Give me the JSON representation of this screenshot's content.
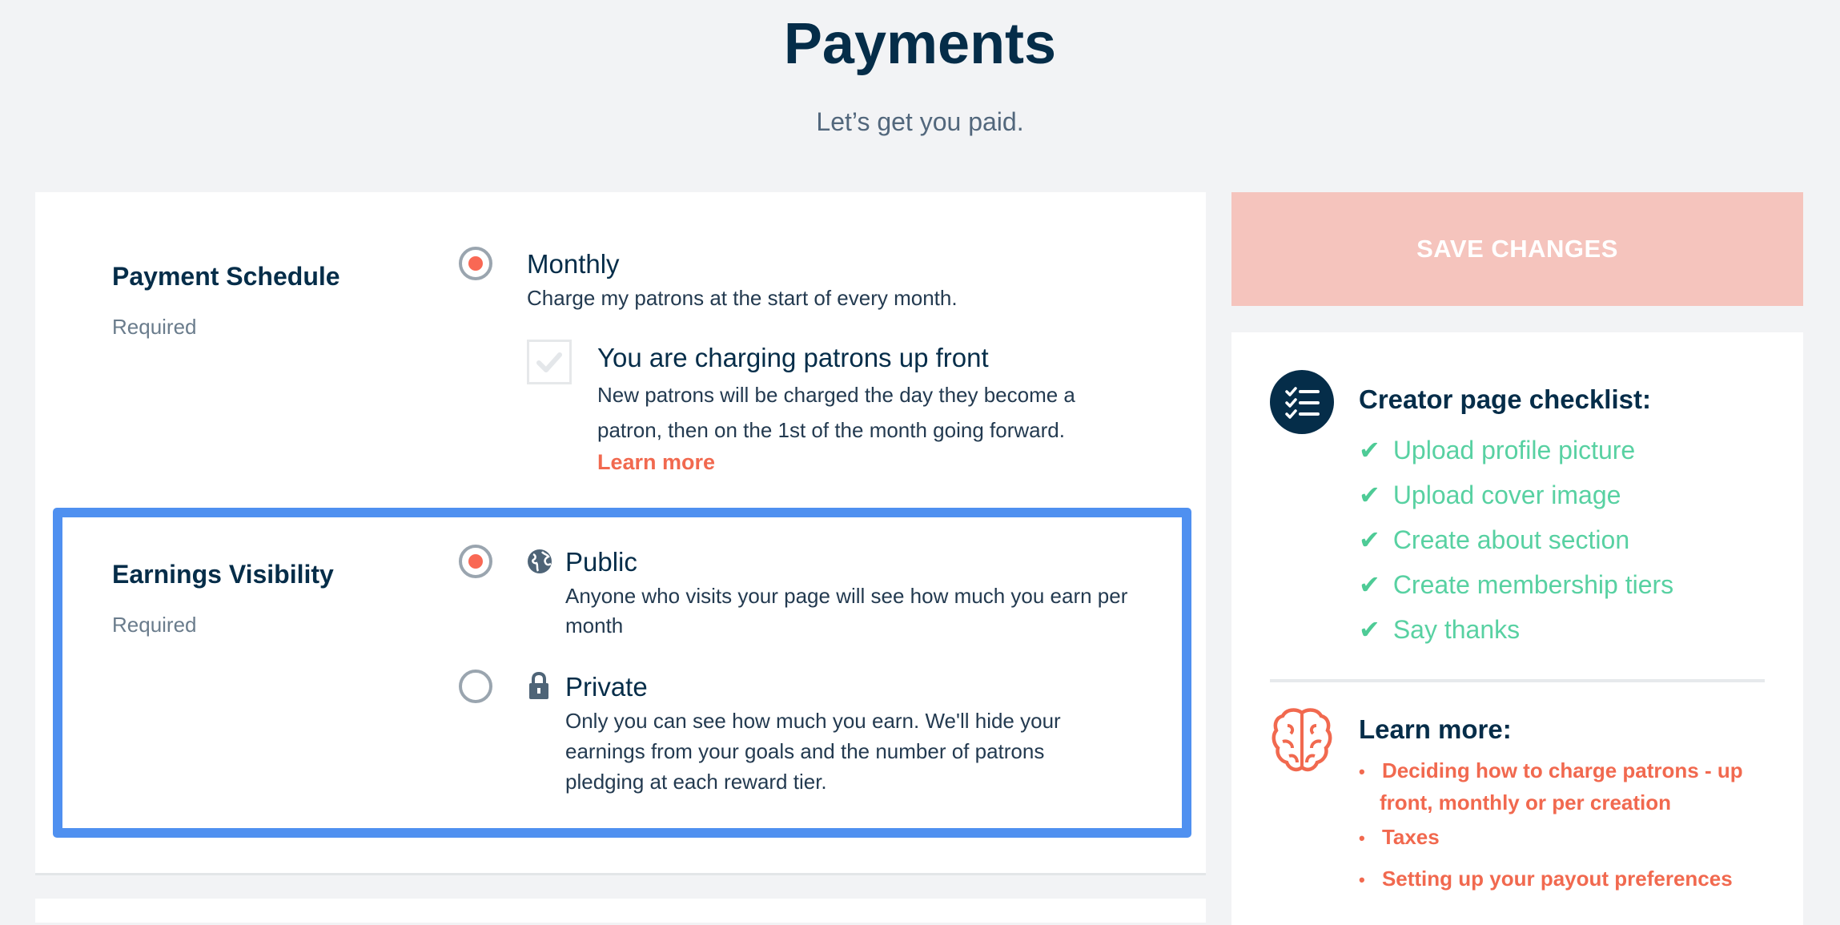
{
  "header": {
    "title": "Payments",
    "subtitle": "Let’s get you paid."
  },
  "payment_schedule": {
    "title": "Payment Schedule",
    "required": "Required",
    "option": {
      "label": "Monthly",
      "description": "Charge my patrons at the start of every month.",
      "selected": true
    },
    "upfront": {
      "label": "You are charging patrons up front",
      "description_line1": "New patrons will be charged the day they become a",
      "description_line2": "patron, then on the 1st of the month going forward.",
      "link": "Learn more",
      "checked": true
    }
  },
  "earnings_visibility": {
    "title": "Earnings Visibility",
    "required": "Required",
    "public": {
      "label": "Public",
      "description_line1": "Anyone who visits your page will see how much you earn per",
      "description_line2": "month",
      "selected": true,
      "icon": "globe-icon"
    },
    "private": {
      "label": "Private",
      "description_line1": "Only you can see how much you earn. We'll hide your",
      "description_line2": "earnings from your goals and the number of patrons",
      "description_line3": "pledging at each reward tier.",
      "selected": false,
      "icon": "lock-icon"
    }
  },
  "sidebar": {
    "save_label": "SAVE CHANGES",
    "checklist": {
      "title": "Creator page checklist:",
      "icon": "checklist-icon",
      "items": [
        "Upload profile picture",
        "Upload cover image",
        "Create about section",
        "Create membership tiers",
        "Say thanks"
      ]
    },
    "learn_more": {
      "title": "Learn more:",
      "icon": "brain-icon",
      "links": [
        {
          "line1": "Deciding how to charge patrons - up",
          "line2": "front, monthly or per creation"
        },
        {
          "line1": "Taxes"
        },
        {
          "line1": "Setting up your payout preferences"
        }
      ]
    }
  },
  "colors": {
    "brand_coral": "#f96854",
    "navy": "#052d49",
    "highlight_blue": "#4f90f0",
    "check_green": "#58d1a2",
    "save_disabled": "#f5c4bd"
  }
}
